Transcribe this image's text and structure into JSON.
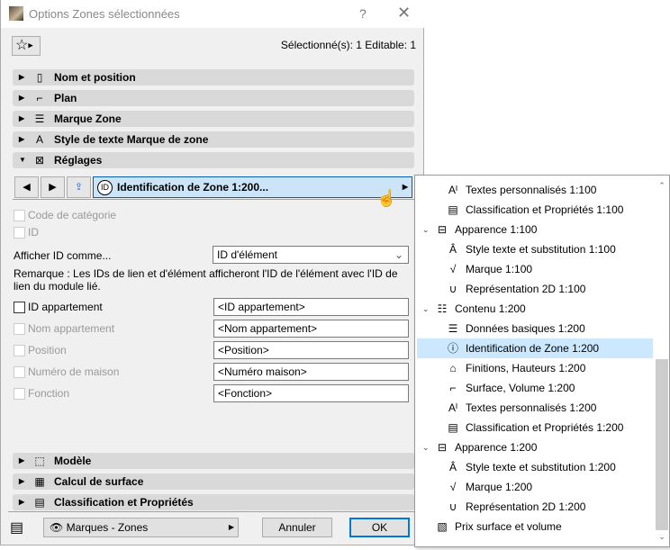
{
  "window": {
    "title": "Options Zones sélectionnées",
    "help": "?",
    "close": "✕"
  },
  "selection_info": "Sélectionné(s): 1 Editable: 1",
  "sections_top": [
    {
      "label": "Nom et position",
      "icon": "▯"
    },
    {
      "label": "Plan",
      "icon": "⌐"
    },
    {
      "label": "Marque Zone",
      "icon": "☰"
    },
    {
      "label": "Style de texte Marque de zone",
      "icon": "A"
    },
    {
      "label": "Réglages",
      "icon": "⊠",
      "expanded": true
    }
  ],
  "panel_nav": {
    "selected": "Identification de Zone 1:200...",
    "id_glyph": "ID"
  },
  "options": {
    "code_categorie": {
      "label": "Code de catégorie",
      "checked": false,
      "enabled": false
    },
    "id": {
      "label": "ID",
      "checked": false,
      "enabled": false
    },
    "afficher_label": "Afficher ID comme...",
    "afficher_value": "ID d'élément",
    "remark": "Remarque : Les IDs de lien et d'élément afficheront l'ID de l'élément avec l'ID de lien du module lié.",
    "rows": [
      {
        "label": "ID appartement",
        "value": "<ID appartement>",
        "enabled": true
      },
      {
        "label": "Nom appartement",
        "value": "<Nom appartement>",
        "enabled": false
      },
      {
        "label": "Position",
        "value": "<Position>",
        "enabled": false
      },
      {
        "label": "Numéro de maison",
        "value": "<Numéro maison>",
        "enabled": false
      },
      {
        "label": "Fonction",
        "value": "<Fonction>",
        "enabled": false
      }
    ]
  },
  "sections_bottom": [
    {
      "label": "Modèle",
      "icon": "⬚"
    },
    {
      "label": "Calcul de surface",
      "icon": "▦"
    },
    {
      "label": "Classification et Propriétés",
      "icon": "▤"
    }
  ],
  "footer": {
    "layer": "Marques - Zones",
    "cancel": "Annuler",
    "ok": "OK"
  },
  "popup_items": [
    {
      "label": "Textes personnalisés 1:100",
      "icon": "Aᴵ",
      "level": 2
    },
    {
      "label": "Classification et Propriétés 1:100",
      "icon": "▤",
      "level": 2
    },
    {
      "label": "Apparence 1:100",
      "icon": "⊟",
      "level": 1,
      "expanded": true
    },
    {
      "label": "Style texte et substitution 1:100",
      "icon": "Â",
      "level": 2
    },
    {
      "label": "Marque 1:100",
      "icon": "√",
      "level": 2
    },
    {
      "label": "Représentation 2D 1:100",
      "icon": "∪",
      "level": 2
    },
    {
      "label": "Contenu 1:200",
      "icon": "☷",
      "level": 1,
      "expanded": true
    },
    {
      "label": "Données basiques 1:200",
      "icon": "☰",
      "level": 2
    },
    {
      "label": "Identification de Zone 1:200",
      "icon": "ⓘ",
      "level": 2,
      "selected": true
    },
    {
      "label": "Finitions, Hauteurs 1:200",
      "icon": "⌂",
      "level": 2
    },
    {
      "label": "Surface, Volume 1:200",
      "icon": "⌐",
      "level": 2
    },
    {
      "label": "Textes personnalisés 1:200",
      "icon": "Aᴵ",
      "level": 2
    },
    {
      "label": "Classification et Propriétés 1:200",
      "icon": "▤",
      "level": 2
    },
    {
      "label": "Apparence 1:200",
      "icon": "⊟",
      "level": 1,
      "expanded": true
    },
    {
      "label": "Style texte et substitution 1:200",
      "icon": "Â",
      "level": 2
    },
    {
      "label": "Marque 1:200",
      "icon": "√",
      "level": 2
    },
    {
      "label": "Représentation 2D 1:200",
      "icon": "∪",
      "level": 2
    },
    {
      "label": "Prix surface et volume",
      "icon": "▧",
      "level": 1
    }
  ],
  "colors": {
    "selection": "#cce8ff",
    "accent": "#0a5ba8"
  }
}
